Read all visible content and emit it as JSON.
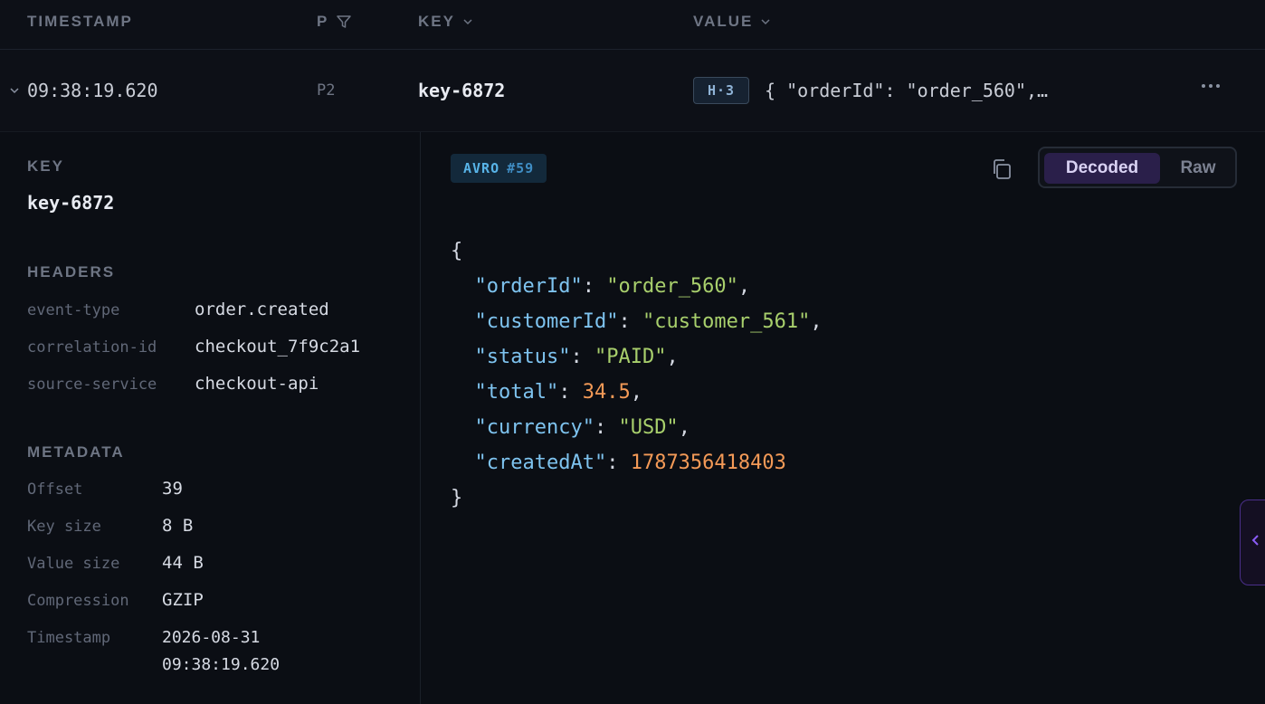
{
  "header": {
    "timestamp": "TIMESTAMP",
    "partition": "P",
    "key": "KEY",
    "value": "VALUE"
  },
  "row": {
    "timestamp": "09:38:19.620",
    "partition": "P2",
    "key": "key-6872",
    "headers_badge": "H·3",
    "value_preview": "{ \"orderId\": \"order_560\",…"
  },
  "detail": {
    "key_title": "KEY",
    "key_value": "key-6872",
    "headers_title": "HEADERS",
    "headers": [
      {
        "name": "event-type",
        "value": "order.created"
      },
      {
        "name": "correlation-id",
        "value": "checkout_7f9c2a1"
      },
      {
        "name": "source-service",
        "value": "checkout-api"
      }
    ],
    "metadata_title": "METADATA",
    "metadata": [
      {
        "label": "Offset",
        "value": "39"
      },
      {
        "label": "Key size",
        "value": "8 B"
      },
      {
        "label": "Value size",
        "value": "44 B"
      },
      {
        "label": "Compression",
        "value": "GZIP"
      },
      {
        "label": "Timestamp",
        "value": "2026-08-31",
        "value2": "09:38:19.620"
      }
    ]
  },
  "viewer": {
    "schema_format": "AVRO",
    "schema_version": "#59",
    "decoded_label": "Decoded",
    "raw_label": "Raw",
    "json": {
      "open": "{",
      "close": "}",
      "fields": [
        {
          "key": "\"orderId\"",
          "value": "\"order_560\"",
          "kind": "string",
          "comma": ","
        },
        {
          "key": "\"customerId\"",
          "value": "\"customer_561\"",
          "kind": "string",
          "comma": ","
        },
        {
          "key": "\"status\"",
          "value": "\"PAID\"",
          "kind": "string",
          "comma": ","
        },
        {
          "key": "\"total\"",
          "value": "34.5",
          "kind": "number",
          "comma": ","
        },
        {
          "key": "\"currency\"",
          "value": "\"USD\"",
          "kind": "string",
          "comma": ","
        },
        {
          "key": "\"createdAt\"",
          "value": "1787356418403",
          "kind": "number",
          "comma": ""
        }
      ]
    }
  },
  "colors": {
    "accent_purple": "#2a1f4a",
    "json_key": "#7ec3ef",
    "json_string": "#a8cf6c",
    "json_number": "#f49a57"
  }
}
